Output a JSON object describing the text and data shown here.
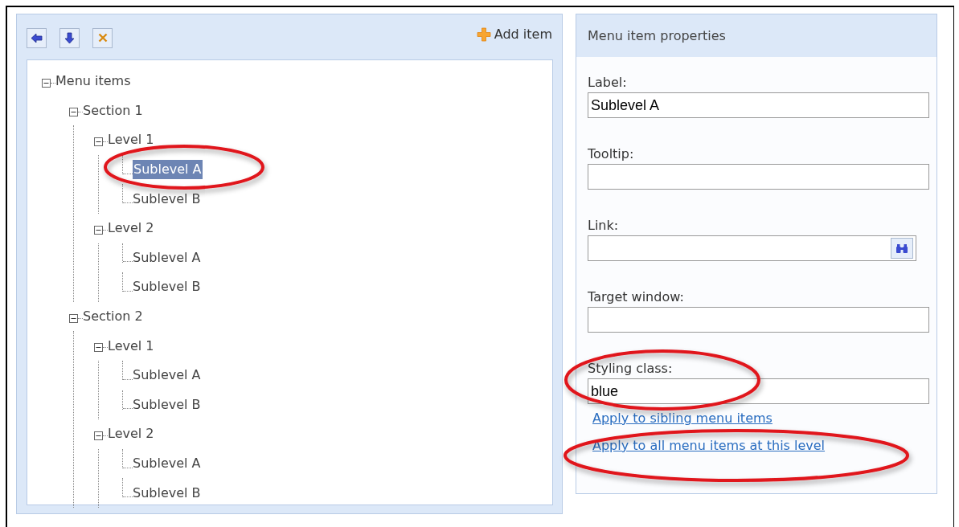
{
  "toolbar": {
    "add_label": "Add item"
  },
  "tree": [
    {
      "label": "Menu items",
      "expanded": true,
      "selected": false,
      "children": [
        {
          "label": "Section 1",
          "expanded": true,
          "selected": false,
          "children": [
            {
              "label": "Level 1",
              "expanded": true,
              "selected": false,
              "children": [
                {
                  "label": "Sublevel A",
                  "selected": true
                },
                {
                  "label": "Sublevel B",
                  "selected": false
                }
              ]
            },
            {
              "label": "Level 2",
              "expanded": true,
              "selected": false,
              "children": [
                {
                  "label": "Sublevel A",
                  "selected": false
                },
                {
                  "label": "Sublevel B",
                  "selected": false
                }
              ]
            }
          ]
        },
        {
          "label": "Section 2",
          "expanded": true,
          "selected": false,
          "children": [
            {
              "label": "Level 1",
              "expanded": true,
              "selected": false,
              "children": [
                {
                  "label": "Sublevel A",
                  "selected": false
                },
                {
                  "label": "Sublevel B",
                  "selected": false
                }
              ]
            },
            {
              "label": "Level 2",
              "expanded": true,
              "selected": false,
              "children": [
                {
                  "label": "Sublevel A",
                  "selected": false
                },
                {
                  "label": "Sublevel B",
                  "selected": false
                }
              ]
            }
          ]
        }
      ]
    }
  ],
  "properties": {
    "title": "Menu item properties",
    "fields": [
      {
        "label": "Label:",
        "kind": "text",
        "value": "Sublevel A"
      },
      {
        "label": "Tooltip:",
        "kind": "text"
      },
      {
        "label": "Link:",
        "kind": "browse"
      },
      {
        "label": "Target window:",
        "kind": "text"
      },
      {
        "label": "Styling class:",
        "kind": "text",
        "value": "blue"
      }
    ],
    "links": [
      "Apply to sibling menu items",
      "Apply to all menu items at this level"
    ]
  }
}
